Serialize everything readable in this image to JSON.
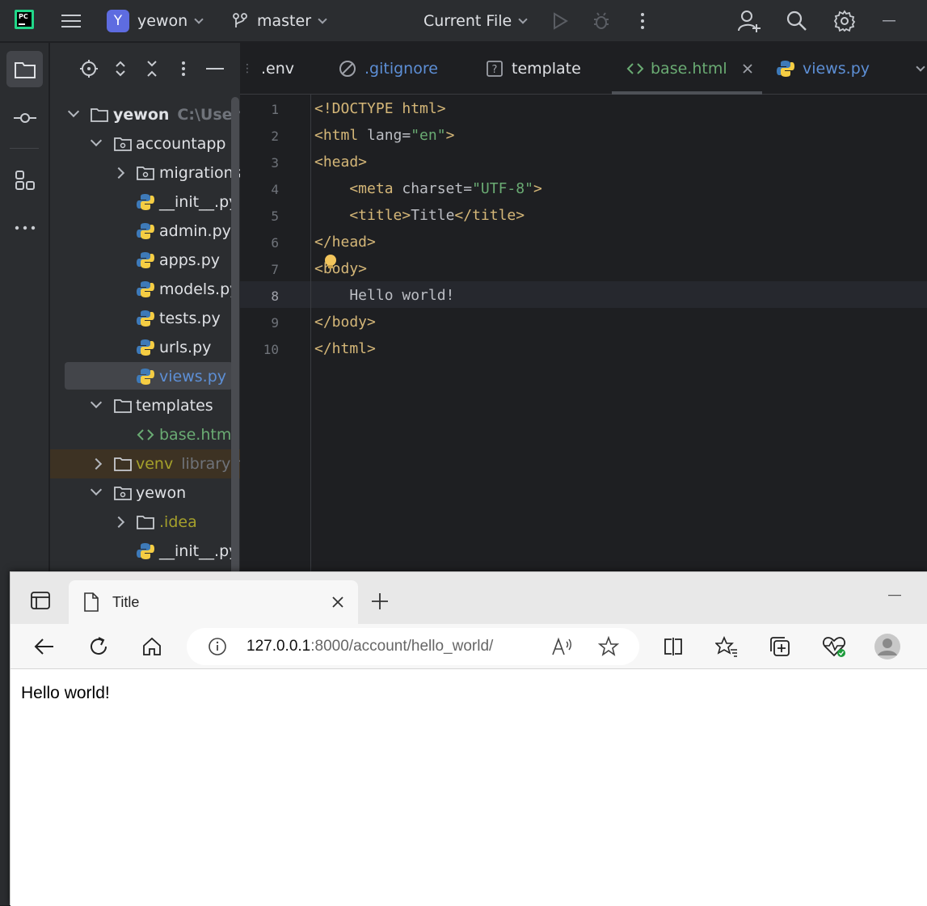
{
  "ide": {
    "project_name": "yewon",
    "project_badge": "Y",
    "branch": "master",
    "run_config": "Current File",
    "tabs": [
      ".env",
      ".gitignore",
      "template",
      "base.html",
      "views.py"
    ],
    "tree": {
      "root": "yewon",
      "root_path": "C:\\Users\\",
      "accountapp": "accountapp",
      "migrations": "migrations",
      "init_py": "__init__.py",
      "admin_py": "admin.py",
      "apps_py": "apps.py",
      "models_py": "models.py",
      "tests_py": "tests.py",
      "urls_py": "urls.py",
      "views_py": "views.py",
      "templates": "templates",
      "base_html": "base.html",
      "venv": "venv",
      "venv_hint": "library ro",
      "yewon_pkg": "yewon",
      "idea": ".idea",
      "init_py_2": "__init__.py"
    },
    "code": {
      "line_numbers": [
        "1",
        "2",
        "3",
        "4",
        "5",
        "6",
        "7",
        "8",
        "9",
        "10"
      ],
      "current_line": 8,
      "l1": "<!DOCTYPE html>",
      "l2_open": "<html ",
      "l2_attr": "lang=",
      "l2_val": "\"en\"",
      "l2_close": ">",
      "l3": "<head>",
      "l4_open": "    <meta ",
      "l4_attr": "charset=",
      "l4_val": "\"UTF-8\"",
      "l4_close": ">",
      "l5_open": "    <title>",
      "l5_text": "Title",
      "l5_close": "</title>",
      "l6": "</head>",
      "l7": "<body>",
      "l8": "    Hello world!",
      "l9": "</body>",
      "l10": "</html>"
    }
  },
  "browser": {
    "tab_title": "Title",
    "url_host": "127.0.0.1",
    "url_rest": ":8000/account/hello_world/",
    "page_text": "Hello world!"
  },
  "colors": {
    "ide_bg": "#1e1f22",
    "ide_panel": "#2b2d30",
    "tag": "#d5b778",
    "string": "#6aab73",
    "python_blue": "#3e7ab8",
    "python_yellow": "#f5cd43",
    "selected_file": "#5d8fd6",
    "excluded": "#a5a02b"
  }
}
